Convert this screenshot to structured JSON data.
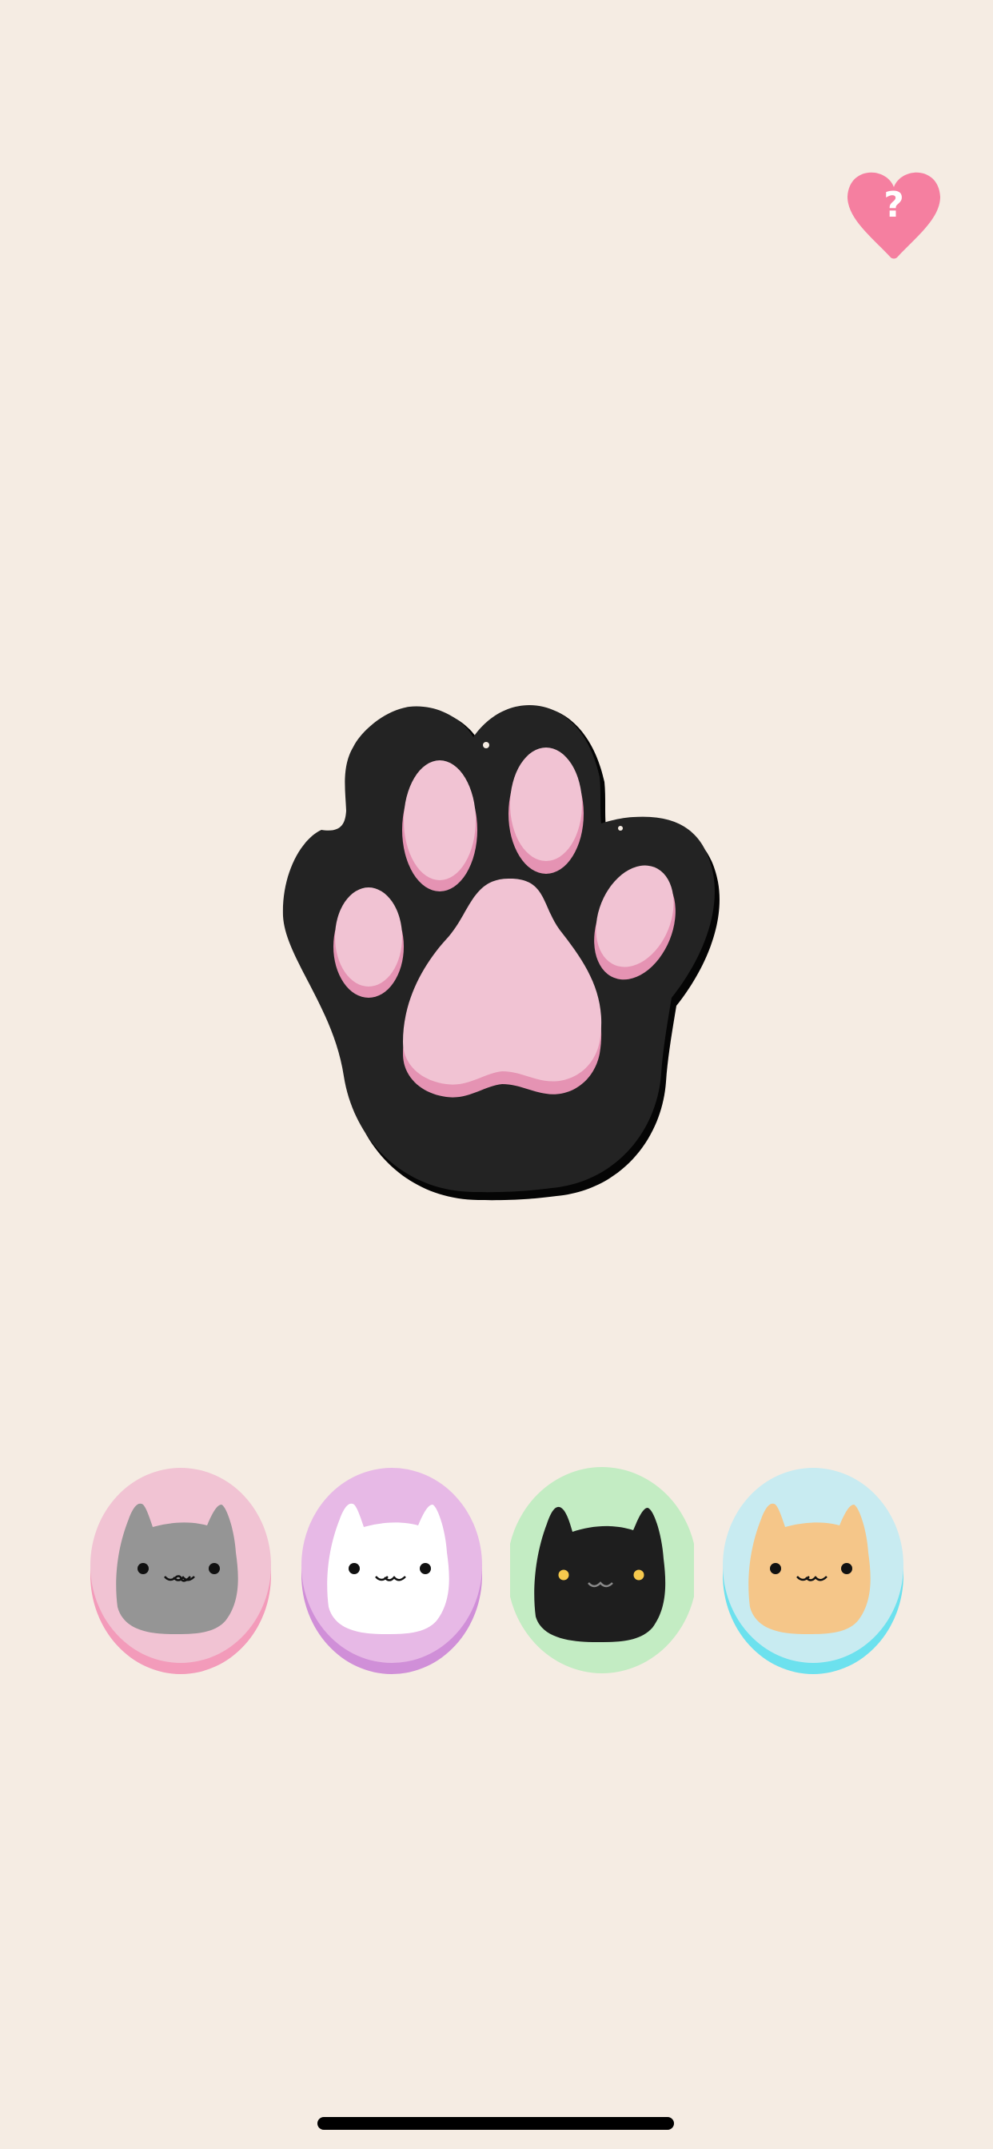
{
  "app": {
    "background_color": "#f5ece3"
  },
  "help_button": {
    "icon": "heart-question-icon",
    "glyph": "?",
    "color": "#f57fa0"
  },
  "paw": {
    "icon": "cat-paw-icon",
    "fill_color": "#232323",
    "pad_color": "#f1c3d3",
    "pad_shadow_color": "#e593b3"
  },
  "cat_selector": [
    {
      "name": "gray-cat",
      "button_color": "#f1c3d3",
      "rim_color": "#f39bba",
      "face_color": "#959595",
      "eye_color": "#111111",
      "selected": false
    },
    {
      "name": "white-cat",
      "button_color": "#e7b9e6",
      "rim_color": "#d08fd8",
      "face_color": "#ffffff",
      "eye_color": "#111111",
      "selected": false
    },
    {
      "name": "black-cat",
      "button_color": "#c3ecc3",
      "rim_color": "#c3ecc3",
      "face_color": "#1e1e1e",
      "eye_color": "#f6c94d",
      "selected": true
    },
    {
      "name": "orange-cat",
      "button_color": "#c8ebf1",
      "rim_color": "#6ce1ee",
      "face_color": "#f5c689",
      "eye_color": "#111111",
      "selected": false
    }
  ]
}
